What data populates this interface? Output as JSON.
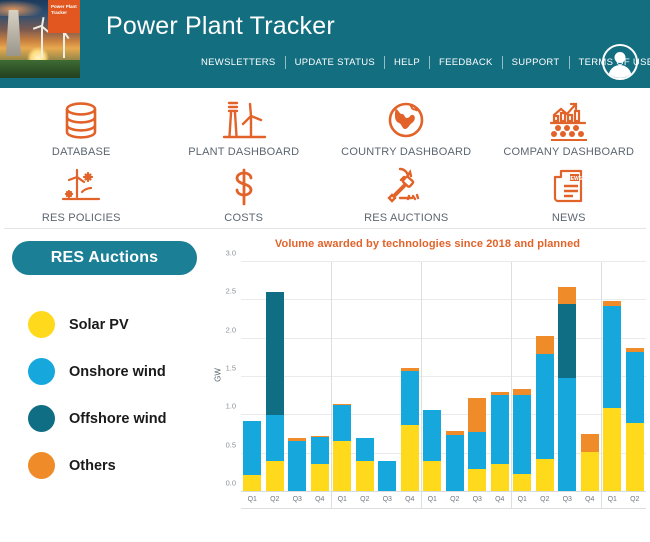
{
  "header": {
    "title": "Power Plant Tracker",
    "logo_tag": "Power Plant Tracker",
    "nav": [
      {
        "label": "NEWSLETTERS"
      },
      {
        "label": "UPDATE STATUS"
      },
      {
        "label": "HELP"
      },
      {
        "label": "FEEDBACK"
      },
      {
        "label": "SUPPORT"
      },
      {
        "label": "TERMS OF USE"
      }
    ],
    "avatar_icon": "user-avatar-icon",
    "bg_color": "#136e80"
  },
  "iconnav": {
    "row1": [
      {
        "label": "DATABASE",
        "icon": "database-icon"
      },
      {
        "label": "PLANT DASHBOARD",
        "icon": "power-plant-icon"
      },
      {
        "label": "COUNTRY DASHBOARD",
        "icon": "globe-icon"
      },
      {
        "label": "COMPANY DASHBOARD",
        "icon": "company-chart-icon"
      }
    ],
    "row2": [
      {
        "label": "RES POLICIES",
        "icon": "renewables-policy-icon"
      },
      {
        "label": "COSTS",
        "icon": "dollar-icon"
      },
      {
        "label": "RES AUCTIONS",
        "icon": "gavel-icon"
      },
      {
        "label": "NEWS",
        "icon": "newspaper-icon"
      }
    ],
    "news_badge": "NEWS",
    "icon_color": "#e2632a",
    "label_color": "#5b6670"
  },
  "sidebar": {
    "pill_label": "RES Auctions",
    "pill_color": "#1b7f96",
    "legend": [
      {
        "label": "Solar PV",
        "color": "#FFD91C"
      },
      {
        "label": "Onshore wind",
        "color": "#16A8DC"
      },
      {
        "label": "Offshore wind",
        "color": "#106E84"
      },
      {
        "label": "Others",
        "color": "#EF8B28"
      }
    ]
  },
  "chart_data": {
    "type": "bar",
    "stacked": true,
    "title": "Volume awarded by technologies since 2018 and planned",
    "title_color": "#e2632a",
    "xlabel": "",
    "ylabel": "GW",
    "ylim": [
      0.0,
      3.0
    ],
    "yticks": [
      "0.0",
      "0.5",
      "1.0",
      "1.5",
      "2.0",
      "2.5",
      "3.0"
    ],
    "ytick_values": [
      0.0,
      0.5,
      1.0,
      1.5,
      2.0,
      2.5,
      3.0
    ],
    "grid": true,
    "legend_position": "left-panel",
    "categories": [
      "Q1",
      "Q2",
      "Q3",
      "Q4",
      "Q1",
      "Q2",
      "Q3",
      "Q4",
      "Q1",
      "Q2",
      "Q3",
      "Q4",
      "Q1",
      "Q2",
      "Q3",
      "Q4",
      "Q1",
      "Q2"
    ],
    "group_breaks": [
      4,
      8,
      12,
      16
    ],
    "series": [
      {
        "name": "Solar PV",
        "color": "#FFD91C",
        "values": [
          0.22,
          0.4,
          0.0,
          0.36,
          0.67,
          0.41,
          0.0,
          0.87,
          0.4,
          0.0,
          0.3,
          0.37,
          0.24,
          0.43,
          0.0,
          0.52,
          1.09,
          0.9
        ]
      },
      {
        "name": "Onshore wind",
        "color": "#16A8DC",
        "values": [
          0.7,
          0.6,
          0.67,
          0.36,
          0.47,
          0.29,
          0.4,
          0.71,
          0.67,
          0.75,
          0.48,
          0.9,
          1.03,
          1.37,
          1.49,
          0.0,
          1.33,
          0.93
        ]
      },
      {
        "name": "Offshore wind",
        "color": "#106E84",
        "values": [
          0.0,
          1.61,
          0.0,
          0.0,
          0.0,
          0.0,
          0.0,
          0.0,
          0.0,
          0.0,
          0.0,
          0.0,
          0.0,
          0.0,
          0.96,
          0.0,
          0.0,
          0.0
        ]
      },
      {
        "name": "Others",
        "color": "#EF8B28",
        "values": [
          0.0,
          0.0,
          0.03,
          0.01,
          0.01,
          0.01,
          0.0,
          0.04,
          0.0,
          0.04,
          0.45,
          0.03,
          0.08,
          0.23,
          0.22,
          0.24,
          0.07,
          0.05
        ]
      }
    ],
    "totals": [
      0.92,
      2.61,
      0.7,
      0.73,
      1.15,
      0.71,
      0.4,
      1.62,
      1.07,
      0.79,
      1.23,
      1.3,
      1.35,
      2.03,
      2.67,
      0.76,
      2.49,
      1.88
    ]
  }
}
